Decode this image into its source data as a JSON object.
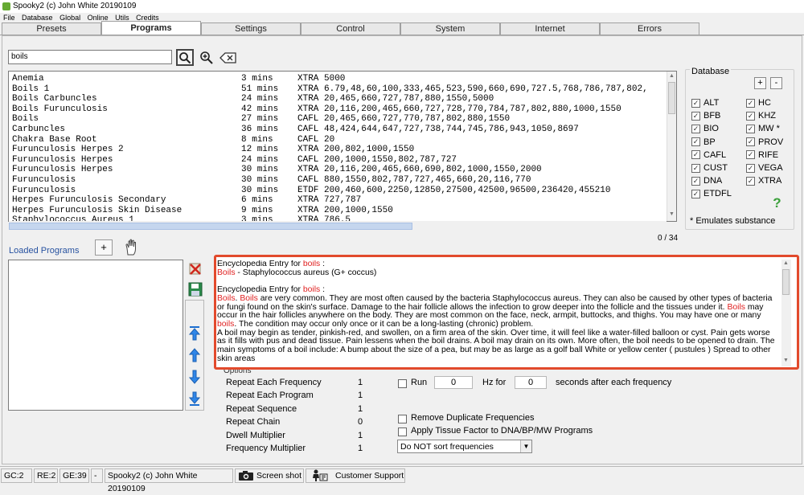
{
  "window": {
    "title": "Spooky2 (c) John White 20190109"
  },
  "menu": [
    "File",
    "Database",
    "Global",
    "Online",
    "Utils",
    "Credits"
  ],
  "tabs": [
    "Presets",
    "Programs",
    "Settings",
    "Control",
    "System",
    "Internet",
    "Errors"
  ],
  "active_tab": "Programs",
  "search": {
    "value": "boils"
  },
  "programs": [
    {
      "name": "Anemia",
      "duration": "3 mins",
      "freqs": "XTRA 5000"
    },
    {
      "name": "Boils 1",
      "duration": "51 mins",
      "freqs": "XTRA 6.79,48,60,100,333,465,523,590,660,690,727.5,768,786,787,802,"
    },
    {
      "name": "Boils Carbuncles",
      "duration": "24 mins",
      "freqs": "XTRA 20,465,660,727,787,880,1550,5000"
    },
    {
      "name": "Boils Furunculosis",
      "duration": "42 mins",
      "freqs": "XTRA 20,116,200,465,660,727,728,770,784,787,802,880,1000,1550"
    },
    {
      "name": "Boils",
      "duration": "27 mins",
      "freqs": "CAFL 20,465,660,727,770,787,802,880,1550"
    },
    {
      "name": "Carbuncles",
      "duration": "36 mins",
      "freqs": "CAFL 48,424,644,647,727,738,744,745,786,943,1050,8697"
    },
    {
      "name": "Chakra Base Root",
      "duration": "8 mins",
      "freqs": "CAFL 20"
    },
    {
      "name": "Furunculosis Herpes 2",
      "duration": "12 mins",
      "freqs": "XTRA 200,802,1000,1550"
    },
    {
      "name": "Furunculosis Herpes",
      "duration": "24 mins",
      "freqs": "CAFL 200,1000,1550,802,787,727"
    },
    {
      "name": "Furunculosis Herpes",
      "duration": "30 mins",
      "freqs": "XTRA 20,116,200,465,660,690,802,1000,1550,2000"
    },
    {
      "name": "Furunculosis",
      "duration": "30 mins",
      "freqs": "CAFL 880,1550,802,787,727,465,660,20,116,770"
    },
    {
      "name": "Furunculosis",
      "duration": "30 mins",
      "freqs": "ETDF 200,460,600,2250,12850,27500,42500,96500,236420,455210"
    },
    {
      "name": "Herpes Furunculosis Secondary",
      "duration": "6 mins",
      "freqs": "XTRA 727,787"
    },
    {
      "name": "Herpes Furunculosis Skin Disease",
      "duration": "9 mins",
      "freqs": "XTRA 200,1000,1550"
    },
    {
      "name": "Staphylococcus Aureus 1",
      "duration": "3 mins",
      "freqs": "XTRA 786.5"
    }
  ],
  "count": "0 / 34",
  "database": {
    "title": "Database",
    "add": "+",
    "remove": "-",
    "left": [
      "ALT",
      "BFB",
      "BIO",
      "BP",
      "CAFL",
      "CUST",
      "DNA",
      "ETDFL"
    ],
    "right": [
      "HC",
      "KHZ",
      "MW *",
      "PROV",
      "RIFE",
      "VEGA",
      "XTRA"
    ],
    "note": "* Emulates substance",
    "help": "?"
  },
  "loaded": {
    "label": "Loaded Programs",
    "add": "+"
  },
  "encyclopedia": {
    "p1_prefix": "Encyclopedia Entry for ",
    "term": "boils",
    "colon": " :",
    "p1_term": "Boils",
    "p1_rest": " - Staphylococcus aureus (G+ coccus)",
    "p2_prefix": "Encyclopedia Entry for ",
    "p2_t1": "Boils",
    "p2_t2": "Boils",
    "p2_a": " are very common. They are most often caused by the bacteria Staphylococcus aureus. They can also be caused by other types of bacteria or fungi found on the skin's surface. Damage to the hair follicle allows the infection to grow deeper into the follicle and the tissues under it. ",
    "p2_t3": "Boils",
    "p2_b": " may occur in the hair follicles anywhere on the body. They are most common on the face, neck, armpit, buttocks, and thighs. You may have one or many ",
    "p2_t4": "boils",
    "p2_c": ". The condition may occur only once or it can be a long-lasting (chronic) problem.",
    "p3": "A boil may begin as tender, pinkish-red, and swollen, on a firm area of the skin. Over time, it will feel like a water-filled balloon or cyst. Pain gets worse as it fills with pus and dead tissue. Pain lessens when the boil drains. A boil may drain on its own. More often, the boil needs to be opened to drain. The main symptoms of a boil include: A bump about the size of a pea, but may be as large as a golf ball White or yellow center ( pustules ) Spread to other skin areas"
  },
  "options": {
    "label": "Options",
    "rows": [
      {
        "label": "Repeat Each Frequency",
        "value": "1"
      },
      {
        "label": "Repeat Each Program",
        "value": "1"
      },
      {
        "label": "Repeat Sequence",
        "value": "1"
      },
      {
        "label": "Repeat Chain",
        "value": "0"
      },
      {
        "label": "Dwell Multiplier",
        "value": "1"
      },
      {
        "label": "Frequency Multiplier",
        "value": "1"
      }
    ],
    "run_label": "Run",
    "run_value": "0",
    "hz_for": "Hz for",
    "hz_value": "0",
    "after": "seconds after each frequency",
    "remove_dup": "Remove Duplicate Frequencies",
    "tissue": "Apply Tissue Factor to DNA/BP/MW Programs",
    "sort": "Do NOT sort frequencies"
  },
  "status": {
    "gc": "GC:2",
    "re": "RE:2",
    "ge": "GE:39",
    "dash": "-",
    "copyright": "Spooky2 (c) John White 20190109",
    "screenshot": "Screen shot",
    "support": "Customer Support"
  }
}
